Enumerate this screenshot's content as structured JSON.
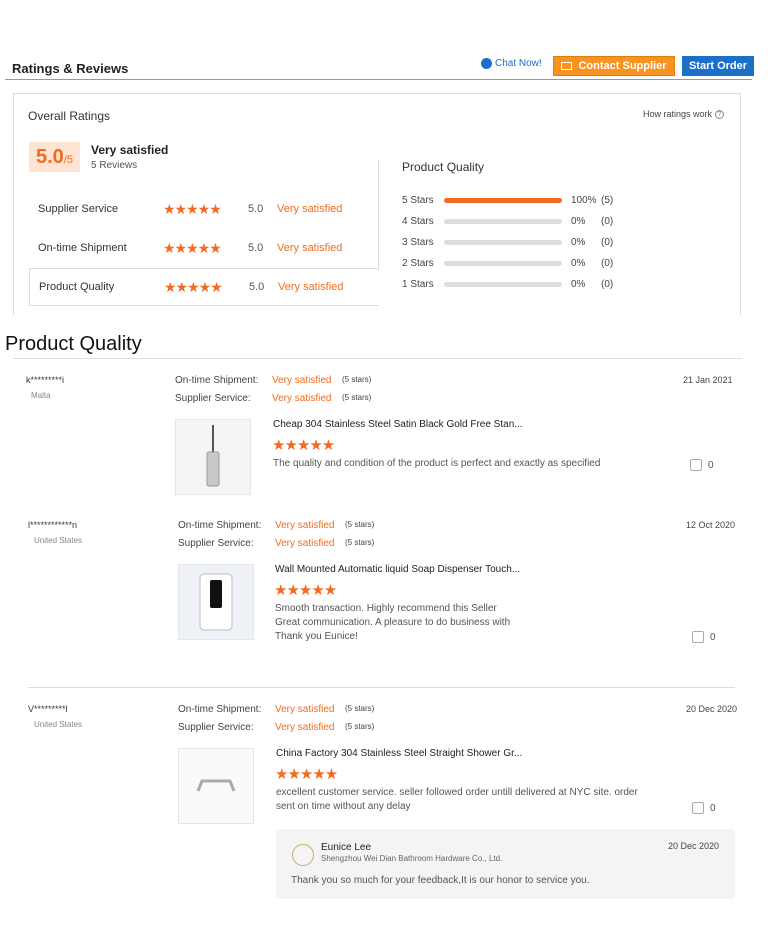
{
  "header": {
    "title": "Ratings & Reviews",
    "chat_label": "Chat Now!",
    "contact_label": "Contact Supplier",
    "start_label": "Start Order"
  },
  "overall": {
    "title": "Overall Ratings",
    "how_ratings": "How ratings work",
    "score": "5.0",
    "score_suffix": "/5",
    "satisfaction": "Very satisfied",
    "review_count": "5 Reviews"
  },
  "categories": [
    {
      "label": "Supplier Service",
      "stars": 5,
      "score": "5.0",
      "text": "Very satisfied"
    },
    {
      "label": "On-time Shipment",
      "stars": 5,
      "score": "5.0",
      "text": "Very satisfied"
    },
    {
      "label": "Product Quality",
      "stars": 5,
      "score": "5.0",
      "text": "Very satisfied"
    }
  ],
  "product_quality": {
    "title": "Product Quality",
    "rows": [
      {
        "label": "5 Stars",
        "percent": 100,
        "pct_text": "100%",
        "count": "(5)"
      },
      {
        "label": "4 Stars",
        "percent": 0,
        "pct_text": "0%",
        "count": "(0)"
      },
      {
        "label": "3 Stars",
        "percent": 0,
        "pct_text": "0%",
        "count": "(0)"
      },
      {
        "label": "2 Stars",
        "percent": 0,
        "pct_text": "0%",
        "count": "(0)"
      },
      {
        "label": "1 Stars",
        "percent": 0,
        "pct_text": "0%",
        "count": "(0)"
      }
    ]
  },
  "section_title": "Product Quality",
  "reviews": [
    {
      "user": "k*********i",
      "country": "Malta",
      "shipment_label": "On-time Shipment:",
      "shipment_val": "Very satisfied",
      "shipment_stars": "(5 stars)",
      "service_label": "Supplier Service:",
      "service_val": "Very satisfied",
      "service_stars": "(5 stars)",
      "date": "21 Jan 2021",
      "product": "Cheap 304 Stainless Steel Satin Black Gold Free Stan...",
      "rating": 5,
      "comment": [
        "The quality and condition of the product is perfect and exactly as specified"
      ],
      "likes": "0"
    },
    {
      "user": "l************n",
      "country": "United States",
      "shipment_label": "On-time Shipment:",
      "shipment_val": "Very satisfied",
      "shipment_stars": "(5 stars)",
      "service_label": "Supplier Service:",
      "service_val": "Very satisfied",
      "service_stars": "(5 stars)",
      "date": "12 Oct 2020",
      "product": "Wall Mounted Automatic liquid Soap Dispenser Touch...",
      "rating": 5,
      "comment": [
        "Smooth transaction. Highly recommend this Seller",
        "Great communication. A pleasure to do business with",
        "Thank you Eunice!"
      ],
      "likes": "0"
    },
    {
      "user": "V*********l",
      "country": "United States",
      "shipment_label": "On-time Shipment:",
      "shipment_val": "Very satisfied",
      "shipment_stars": "(5 stars)",
      "service_label": "Supplier Service:",
      "service_val": "Very satisfied",
      "service_stars": "(5 stars)",
      "date": "20 Dec 2020",
      "product": "China Factory 304 Stainless Steel Straight Shower Gr...",
      "rating": 5,
      "comment": [
        "excellent customer service. seller followed order untill delivered at NYC site. order",
        "sent on time without any delay"
      ],
      "likes": "0"
    }
  ],
  "reply": {
    "name": "Eunice Lee",
    "company": "Shengzhou Wei Dian Bathroom Hardware Co., Ltd.",
    "date": "20 Dec 2020",
    "text": "Thank you so much for your feedback,It is our honor to service you."
  },
  "colors": {
    "accent": "#f26b21",
    "blue": "#1a6fc9",
    "contact_btn": "#f7931e"
  }
}
